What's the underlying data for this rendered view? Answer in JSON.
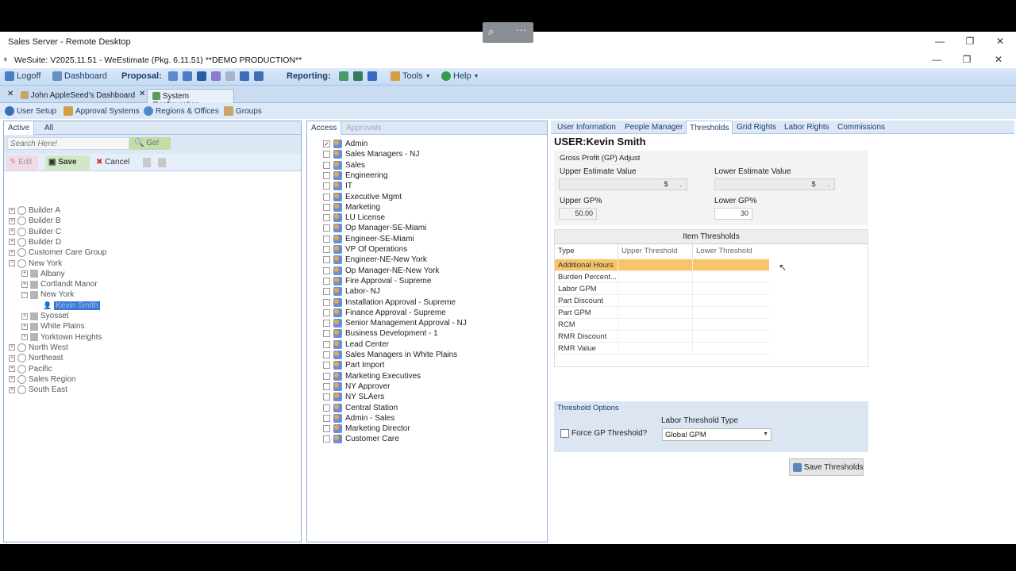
{
  "rd": {
    "title": "Sales Server - Remote Desktop"
  },
  "app": {
    "title": "WeSuite: V2025.11.51 - WeEstimate (Pkg. 6.11.51) **DEMO PRODUCTION**"
  },
  "zoombar": {
    "zoom_icon": "magnifier-icon",
    "more": "···"
  },
  "toolbar": {
    "logoff": "Logoff",
    "dashboard": "Dashboard",
    "proposal": "Proposal:",
    "reporting": "Reporting:",
    "tools": "Tools",
    "help": "Help"
  },
  "doctabs": {
    "tab1": "John AppleSeed's Dashboard",
    "tab2": "System Configuration"
  },
  "subtabs": {
    "user_setup": "User Setup",
    "approval": "Approval Systems",
    "regions": "Regions & Offices",
    "groups": "Groups"
  },
  "left": {
    "tab_active": "Active",
    "tab_all": "All",
    "search_placeholder": "Search Here!",
    "go": "Go!",
    "edit": "Edit",
    "save": "Save",
    "cancel": "Cancel",
    "tree": [
      {
        "label": "Builder A"
      },
      {
        "label": "Builder B"
      },
      {
        "label": "Builder C"
      },
      {
        "label": "Builder D"
      },
      {
        "label": "Customer Care Group"
      },
      {
        "label": "New York"
      },
      {
        "label": "Albany"
      },
      {
        "label": "Cortlandt Manor"
      },
      {
        "label": "New York"
      },
      {
        "label": "Kevin Smith"
      },
      {
        "label": "Syosset"
      },
      {
        "label": "White Plains"
      },
      {
        "label": "Yorktown Heights"
      },
      {
        "label": "North West"
      },
      {
        "label": "Northeast"
      },
      {
        "label": "Pacific"
      },
      {
        "label": "Sales Region"
      },
      {
        "label": "South East"
      }
    ]
  },
  "mid": {
    "tab_access": "Access",
    "tab_approvals": "Approvals",
    "groups": [
      {
        "label": "Admin",
        "checked": "✓"
      },
      {
        "label": "Sales Managers - NJ"
      },
      {
        "label": "Sales"
      },
      {
        "label": "Engineering"
      },
      {
        "label": "IT"
      },
      {
        "label": "Executive Mgmt"
      },
      {
        "label": "Marketing"
      },
      {
        "label": "LU License"
      },
      {
        "label": "Op Manager-SE-Miami"
      },
      {
        "label": "Engineer-SE-Miami"
      },
      {
        "label": "VP Of Operations"
      },
      {
        "label": "Engineer-NE-New York"
      },
      {
        "label": "Op Manager-NE-New York"
      },
      {
        "label": "Fire Approval - Supreme"
      },
      {
        "label": "Labor- NJ"
      },
      {
        "label": "Installation Approval - Supreme"
      },
      {
        "label": "Finance Approval - Supreme"
      },
      {
        "label": "Senior Management Approval - NJ"
      },
      {
        "label": "Business Development - 1"
      },
      {
        "label": "Lead Center"
      },
      {
        "label": "Sales Managers in White Plains"
      },
      {
        "label": "Part Import"
      },
      {
        "label": "Marketing Executives"
      },
      {
        "label": "NY Approver"
      },
      {
        "label": "NY SLAers"
      },
      {
        "label": "Central Station"
      },
      {
        "label": "Admin - Sales"
      },
      {
        "label": "Marketing Director"
      },
      {
        "label": "Customer Care"
      }
    ]
  },
  "right": {
    "tabs": [
      "User Information",
      "People Manager",
      "Thresholds",
      "Grid Rights",
      "Labor Rights",
      "Commissions"
    ],
    "user": "USER:Kevin Smith",
    "gp_section": "Gross Profit (GP) Adjust",
    "upper_est_lbl": "Upper Estimate Value",
    "lower_est_lbl": "Lower Estimate Value",
    "upper_est_val": "$      .",
    "lower_est_val": "$      .",
    "upper_gp_lbl": "Upper GP%",
    "lower_gp_lbl": "Lower GP%",
    "upper_gp_val": "50.00",
    "lower_gp_val": "30",
    "item_thresholds": "Item Thresholds",
    "cols": [
      "Type",
      "Upper Threshold",
      "Lower Threshold"
    ],
    "rows": [
      "Additional Hours",
      "Burden Percent...",
      "Labor GPM",
      "Part Discount",
      "Part GPM",
      "RCM",
      "RMR Discount",
      "RMR Value"
    ],
    "threshold_options": "Threshold Options",
    "force_gp": "Force GP Threshold?",
    "labor_type_lbl": "Labor Threshold Type",
    "labor_type_val": "Global GPM",
    "save_thresholds": "Save Thresholds"
  },
  "colors": {
    "accent": "#1d3b6a",
    "highlight": "#f7c46a",
    "selected": "#3b78d8"
  }
}
